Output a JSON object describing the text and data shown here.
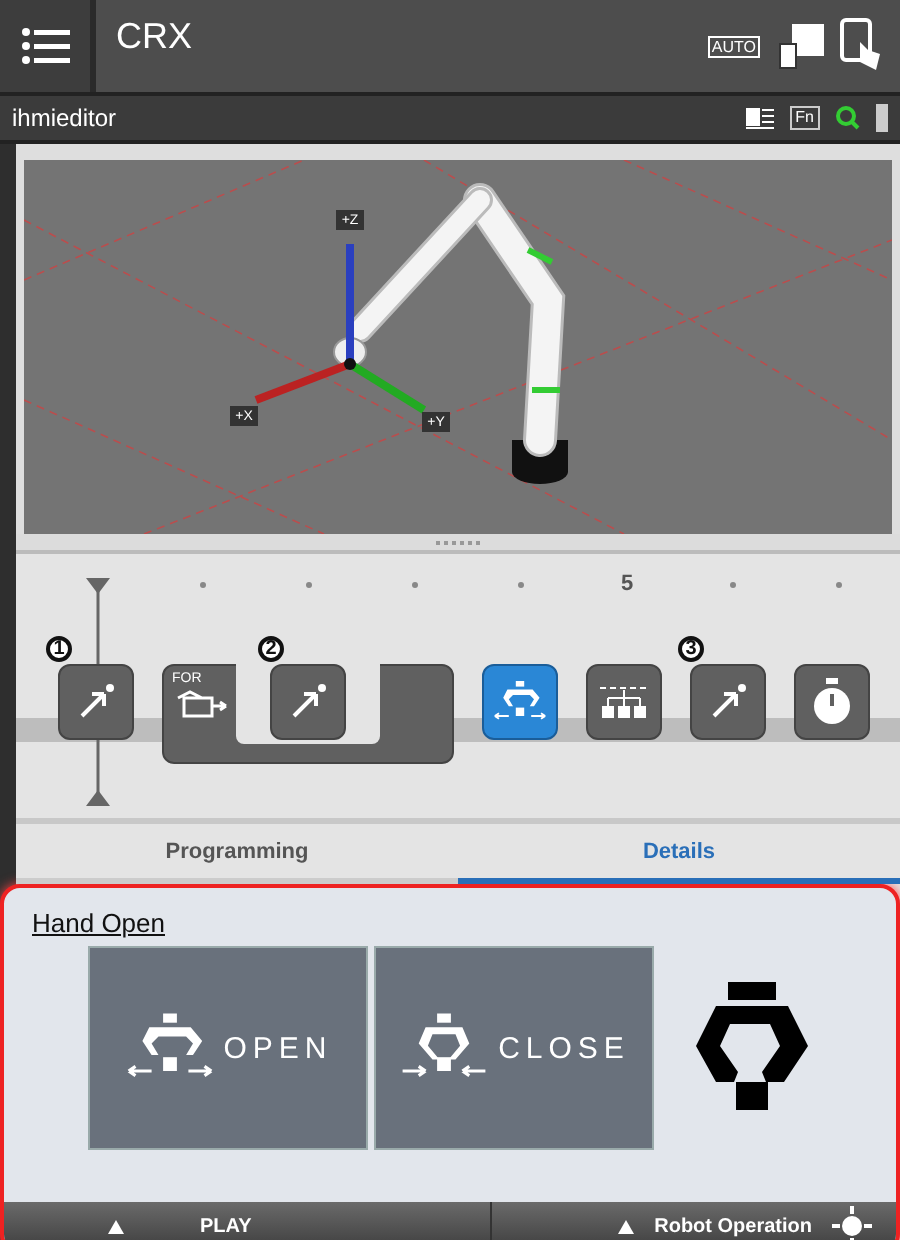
{
  "header": {
    "title": "CRX",
    "mode_label": "AUTO"
  },
  "subbar": {
    "title": "ihmieditor",
    "fn_label": "Fn"
  },
  "viewport": {
    "axes": [
      {
        "kind": "z",
        "label": "+Z"
      },
      {
        "kind": "x",
        "label": "+X"
      },
      {
        "kind": "y",
        "label": "+Y"
      }
    ]
  },
  "timeline": {
    "ruler_label": "5",
    "items": [
      {
        "kind": "move",
        "marker": "1",
        "selected": false
      },
      {
        "kind": "for",
        "label": "FOR",
        "selected": false,
        "children": [
          {
            "kind": "move",
            "marker": "2",
            "selected": false
          }
        ]
      },
      {
        "kind": "gripper",
        "selected": true
      },
      {
        "kind": "io",
        "selected": false
      },
      {
        "kind": "move",
        "marker": "3",
        "selected": false
      },
      {
        "kind": "timer",
        "selected": false
      }
    ]
  },
  "tabs": [
    {
      "label": "Programming",
      "selected": false
    },
    {
      "label": "Details",
      "selected": true
    }
  ],
  "details": {
    "title": "Hand Open",
    "buttons": [
      {
        "kind": "open",
        "label": "OPEN"
      },
      {
        "kind": "close",
        "label": "CLOSE"
      }
    ]
  },
  "status_bar": {
    "left": "PLAY",
    "right": "Robot Operation"
  }
}
